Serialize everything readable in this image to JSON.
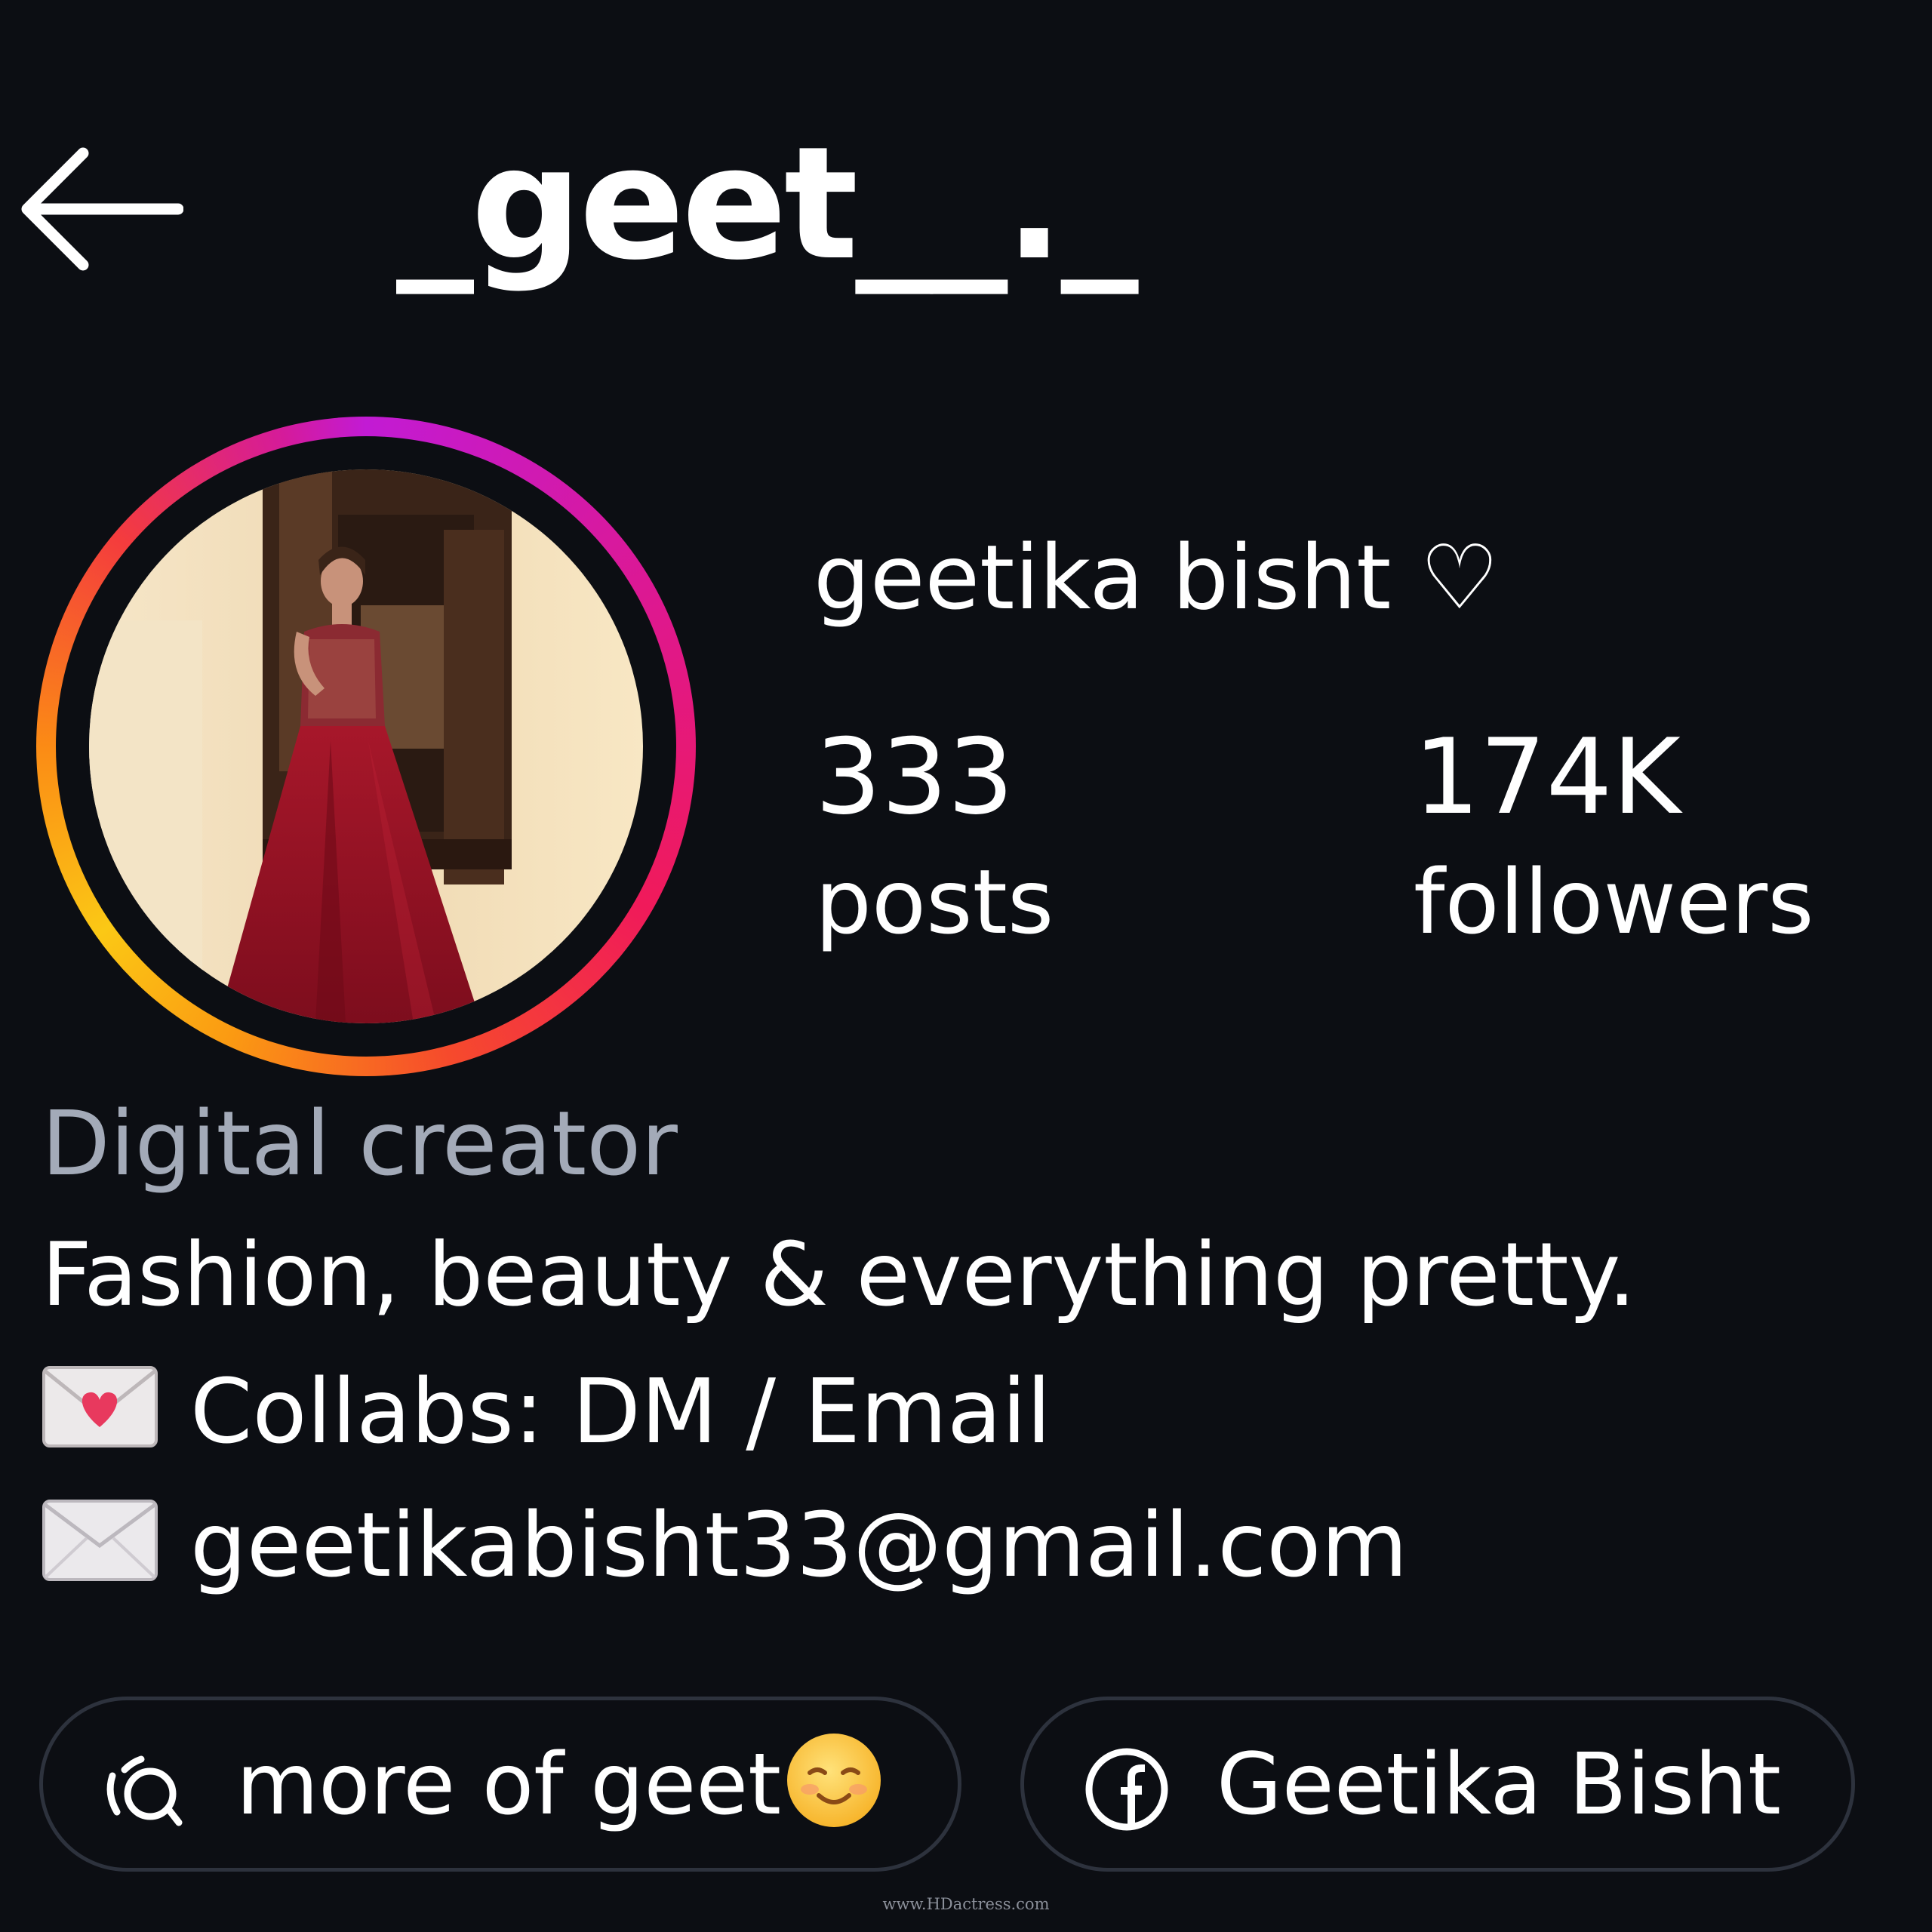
{
  "header": {
    "back_icon": "arrow-left-icon",
    "username": "_geet__._"
  },
  "profile": {
    "display_name": "geetika bisht ♡",
    "avatar": "profile-photo",
    "story_ring_colors": [
      "#c21bd4",
      "#f01a5a",
      "#fb9a12",
      "#fbc815"
    ],
    "stats": {
      "posts_value": "333",
      "posts_label": "posts",
      "followers_value": "174K",
      "followers_label": "followers"
    }
  },
  "bio": {
    "category": "Digital creator",
    "line1": "Fashion, beauty & everything pretty.",
    "line2_icon": "love-letter-emoji-icon",
    "line2": "Collabs: DM / Email",
    "line3_icon": "envelope-emoji-icon",
    "line3": "geetikabisht33@gmail.com"
  },
  "links": {
    "threads": {
      "icon": "threads-icon",
      "label": "more of geet",
      "emoji": "smiling-face-emoji-icon"
    },
    "facebook": {
      "icon": "facebook-icon",
      "label": "Geetika Bisht"
    }
  },
  "colors": {
    "background": "#0c0e13",
    "text": "#ffffff",
    "category_text": "#a3aab8",
    "pill_border": "#2d323d"
  },
  "watermark": "www.HDactress.com"
}
